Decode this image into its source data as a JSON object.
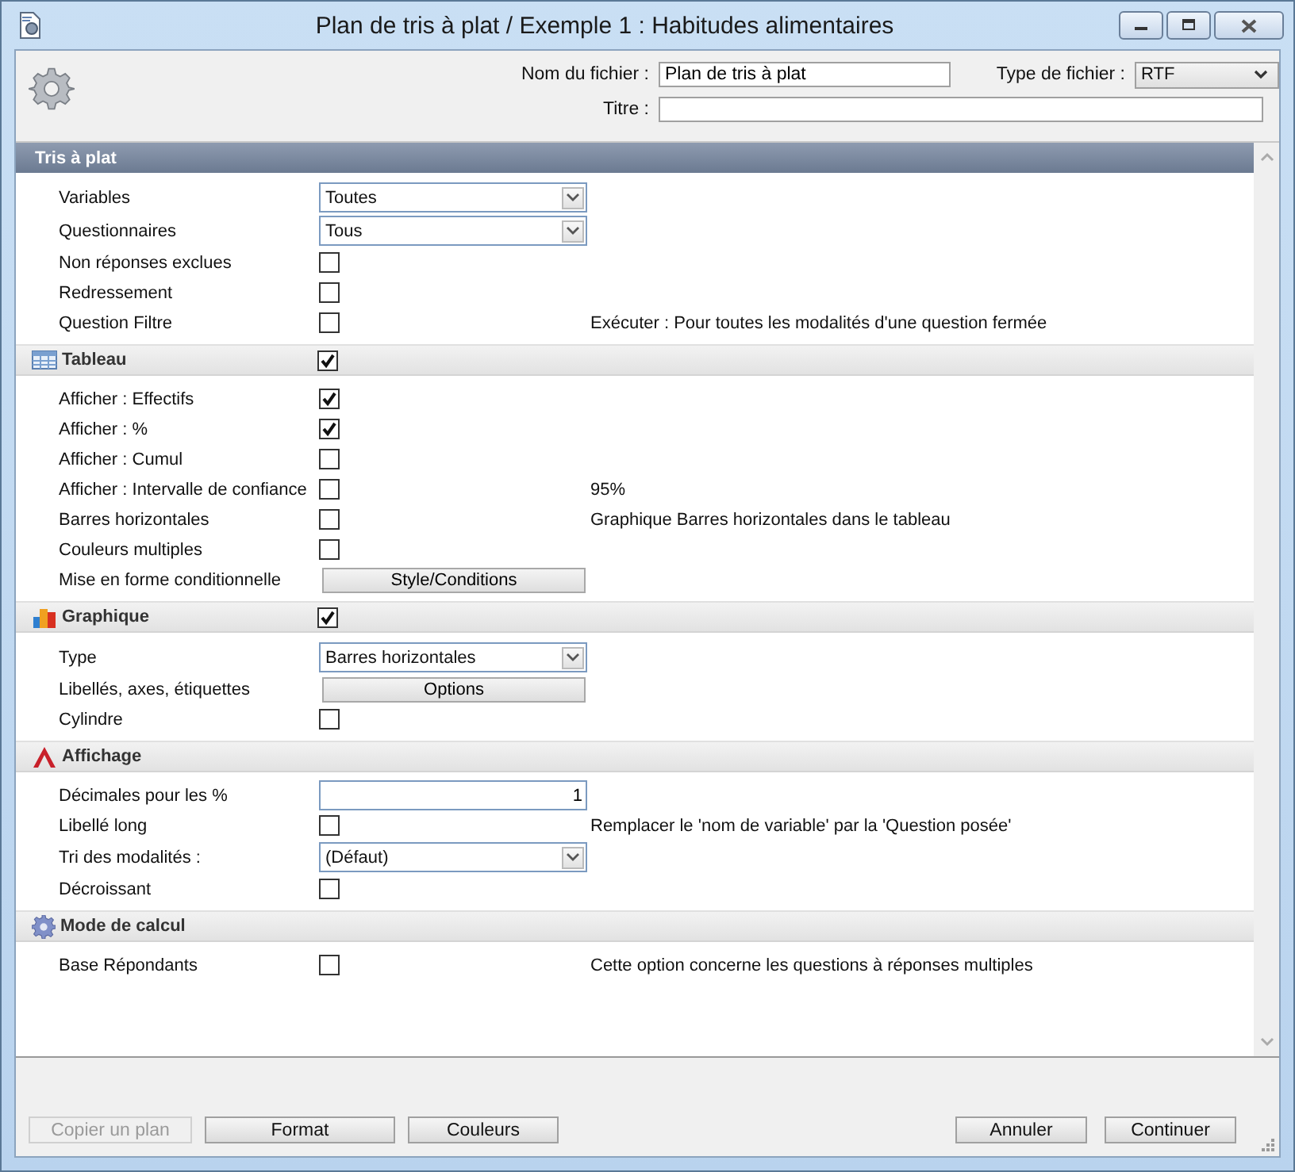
{
  "window": {
    "title": "Plan de tris à plat / Exemple 1 : Habitudes alimentaires"
  },
  "header": {
    "file_name": {
      "label": "Nom du fichier :",
      "value": "Plan de tris à plat"
    },
    "file_type": {
      "label": "Type de fichier :",
      "value": "RTF"
    },
    "title_field": {
      "label": "Titre :"
    }
  },
  "sections": [
    {
      "kind": "main",
      "title": "Tris à plat",
      "rows": [
        {
          "kind": "select",
          "label": "Variables",
          "value": "Toutes"
        },
        {
          "kind": "select",
          "label": "Questionnaires",
          "value": "Tous"
        },
        {
          "kind": "checkbox",
          "label": "Non réponses exclues",
          "checked": false
        },
        {
          "kind": "checkbox",
          "label": "Redressement",
          "checked": false
        },
        {
          "kind": "checkbox",
          "label": "Question Filtre",
          "checked": false,
          "note": "Exécuter : Pour toutes les modalités d'une question fermée"
        }
      ]
    },
    {
      "kind": "group",
      "title": "Tableau",
      "checked": true,
      "rows": [
        {
          "kind": "checkbox",
          "label": "Afficher : Effectifs",
          "checked": true
        },
        {
          "kind": "checkbox",
          "label": "Afficher : %",
          "checked": true
        },
        {
          "kind": "checkbox",
          "label": "Afficher : Cumul",
          "checked": false
        },
        {
          "kind": "checkbox",
          "label": "Afficher : Intervalle de confiance",
          "checked": false,
          "note": "95%"
        },
        {
          "kind": "checkbox",
          "label": "Barres horizontales",
          "checked": false,
          "note": "Graphique Barres horizontales dans le tableau"
        },
        {
          "kind": "checkbox",
          "label": "Couleurs multiples",
          "checked": false
        },
        {
          "kind": "button",
          "label": "Mise en forme conditionnelle",
          "value": "Style/Conditions"
        }
      ]
    },
    {
      "kind": "group",
      "title": "Graphique",
      "checked": true,
      "rows": [
        {
          "kind": "select",
          "label": "Type",
          "value": "Barres horizontales"
        },
        {
          "kind": "button",
          "label": "Libellés, axes, étiquettes",
          "value": "Options"
        },
        {
          "kind": "checkbox",
          "label": "Cylindre",
          "checked": false
        }
      ]
    },
    {
      "kind": "group",
      "title": "Affichage",
      "rows": [
        {
          "kind": "input",
          "label": "Décimales pour les %",
          "value": "1"
        },
        {
          "kind": "checkbox",
          "label": "Libellé long",
          "checked": false,
          "note": "Remplacer le 'nom de variable' par la 'Question posée'"
        },
        {
          "kind": "select",
          "label": "Tri des modalités :",
          "value": "(Défaut)"
        },
        {
          "kind": "checkbox",
          "label": "Décroissant",
          "checked": false
        }
      ]
    },
    {
      "kind": "group",
      "title": "Mode de calcul",
      "rows": [
        {
          "kind": "checkbox",
          "label": "Base Répondants",
          "checked": false,
          "note": "Cette option concerne les questions à réponses multiples"
        }
      ]
    }
  ],
  "footer": {
    "left_buttons": [
      {
        "label": "Copier un plan",
        "disabled": true
      },
      {
        "label": "Format",
        "disabled": false
      },
      {
        "label": "Couleurs",
        "disabled": false
      }
    ],
    "right_buttons": [
      {
        "label": "Annuler",
        "disabled": false
      },
      {
        "label": "Continuer",
        "disabled": false
      }
    ]
  }
}
